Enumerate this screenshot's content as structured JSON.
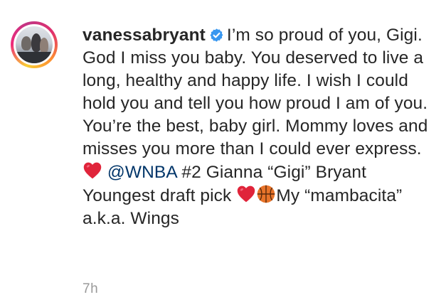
{
  "comment": {
    "username": "vanessabryant",
    "verified": true,
    "text_part1": "I’m so proud of you, Gigi. God I miss you baby. You deserved to live a long, healthy and happy life. I wish I could hold you and tell you how proud I am of you. You’re the best, baby girl. Mommy loves and misses you more than I could ever express.",
    "mention": "@WNBA",
    "text_part2": "#2 Gianna “Gigi” Bryant Youngest draft pick",
    "text_part3": "My “mambacita” a.k.a. Wings",
    "emojis": [
      "red-heart",
      "red-heart",
      "basketball"
    ],
    "timestamp": "7h"
  },
  "colors": {
    "text": "#262626",
    "mention": "#003569",
    "verified_badge": "#3897f0",
    "timestamp": "#999999",
    "heart": "#e0243a",
    "basketball": "#e8742a"
  }
}
